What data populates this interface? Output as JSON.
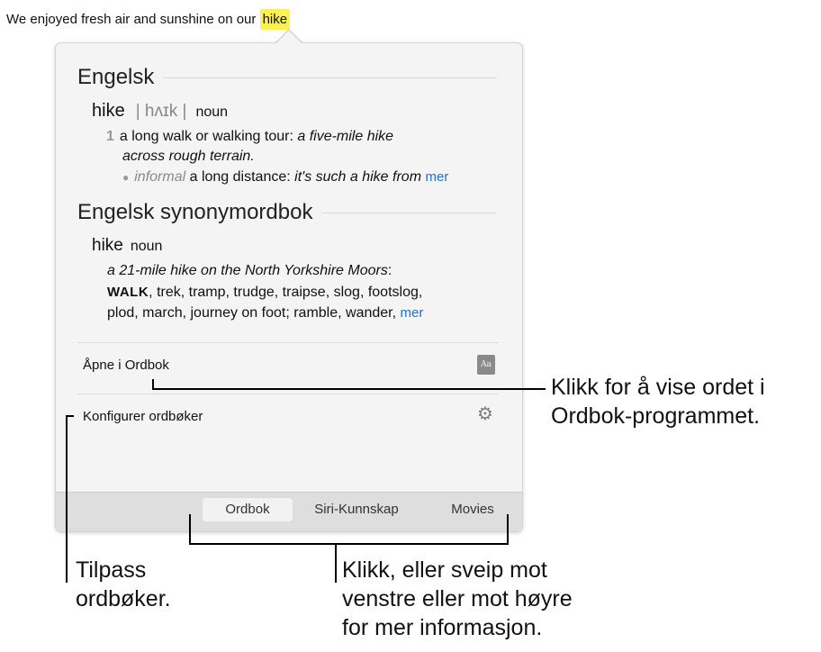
{
  "sentence": {
    "prefix": "We enjoyed fresh air and sunshine on our ",
    "highlighted": "hike"
  },
  "dictionary": {
    "title": "Engelsk",
    "headword": "hike",
    "pronunciation": "| hʌɪk |",
    "part_of_speech": "noun",
    "def_number": "1",
    "def_text": "a long walk or walking tour:",
    "def_example_1": "a five-mile hike",
    "def_example_2": "across rough terrain.",
    "sub_label": "informal",
    "sub_text": "a long distance:",
    "sub_example": "it's such a hike from",
    "more_label": "mer"
  },
  "thesaurus": {
    "title": "Engelsk synonymordbok",
    "headword": "hike",
    "part_of_speech": "noun",
    "example": "a 21-mile hike on the North Yorkshire Moors",
    "example_colon": ":",
    "syn_main": "WALK",
    "syn_line1": ", trek, tramp, trudge, traipse, slog, footslog,",
    "syn_line2": "plod, march, journey on foot; ramble, wander,",
    "more_label": "mer"
  },
  "actions": {
    "open_dictionary": "Åpne i Ordbok",
    "open_icon": "book-icon",
    "configure": "Konfigurer ordbøker",
    "configure_icon": "gear-icon"
  },
  "tabs": [
    {
      "label": "Ordbok",
      "active": true
    },
    {
      "label": "Siri-Kunnskap",
      "active": false
    },
    {
      "label": "Movies",
      "active": false
    }
  ],
  "callouts": {
    "open_line1": "Klikk for å vise ordet i",
    "open_line2": "Ordbok-programmet.",
    "configure_line1": "Tilpass",
    "configure_line2": "ordbøker.",
    "tabs_line1": "Klikk, eller sveip mot",
    "tabs_line2": "venstre eller mot høyre",
    "tabs_line3": "for mer informasjon."
  },
  "colors": {
    "highlight": "#fdf055",
    "link": "#1f6fd6",
    "popover_bg": "#f4f4f4",
    "tabbar_bg": "#dedede"
  }
}
